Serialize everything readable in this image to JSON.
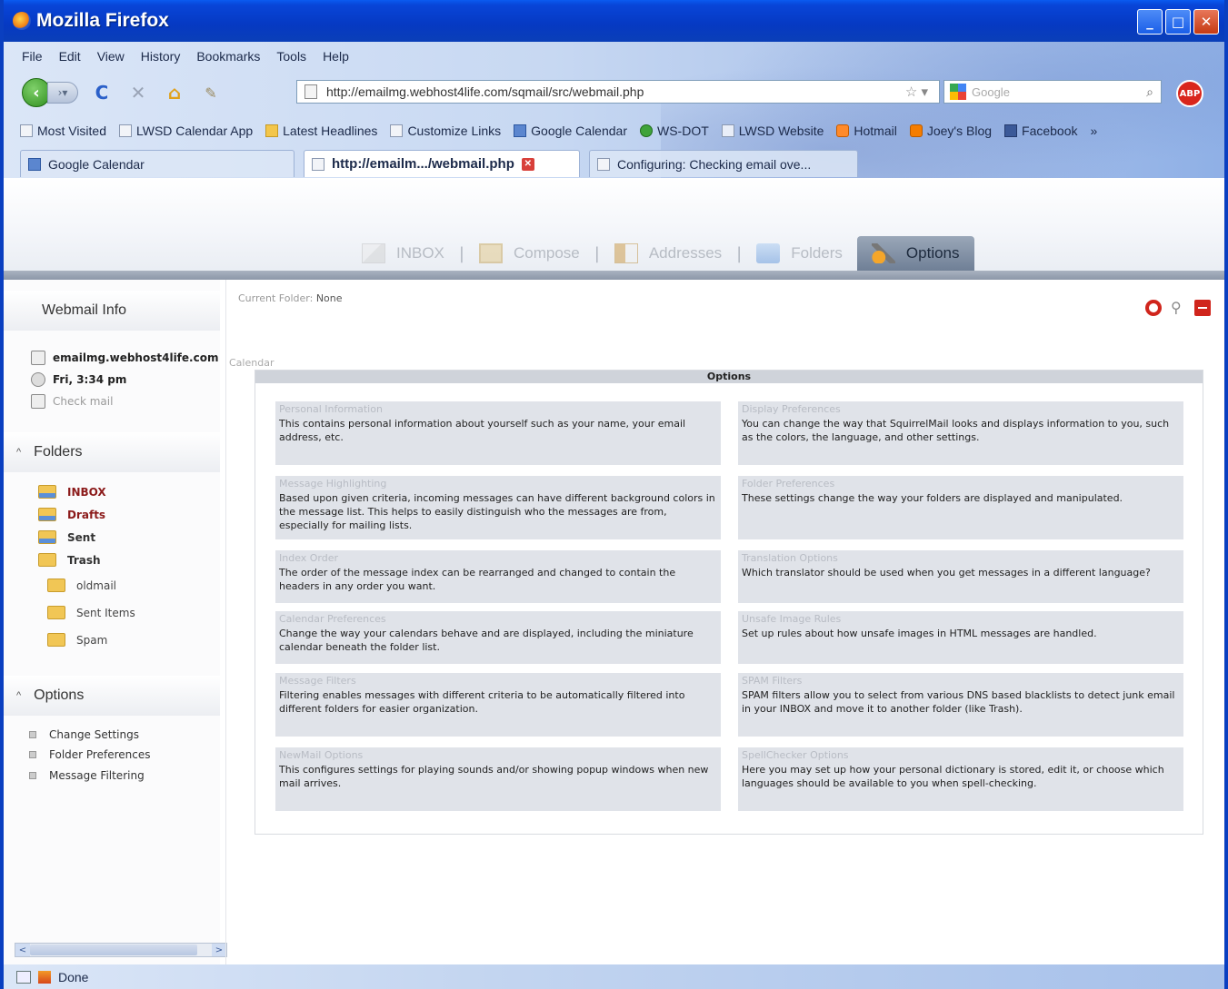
{
  "window": {
    "title": "Mozilla Firefox"
  },
  "menu": [
    "File",
    "Edit",
    "View",
    "History",
    "Bookmarks",
    "Tools",
    "Help"
  ],
  "toolbar": {
    "url": "http://emailmg.webhost4life.com/sqmail/src/webmail.php",
    "search_placeholder": "Google",
    "abp": "ABP"
  },
  "bookmarks": [
    "Most Visited",
    "LWSD Calendar App",
    "Latest Headlines",
    "Customize Links",
    "Google Calendar",
    "WS-DOT",
    "LWSD Website",
    "Hotmail",
    "Joey's Blog",
    "Facebook",
    "»"
  ],
  "tabs": [
    "Google Calendar",
    "http://emailm.../webmail.php",
    "Configuring: Checking email ove..."
  ],
  "sm_nav": [
    "INBOX",
    "Compose",
    "Addresses",
    "Folders",
    "Options"
  ],
  "sidebar": {
    "info_title": "Webmail Info",
    "server": "emailmg.webhost4life.com",
    "time": "Fri, 3:34 pm",
    "check_mail": "Check mail",
    "folders_title": "Folders",
    "folders": [
      "INBOX",
      "Drafts",
      "Sent",
      "Trash",
      "oldmail",
      "Sent Items",
      "Spam"
    ],
    "options_title": "Options",
    "options": [
      "Change Settings",
      "Folder Preferences",
      "Message Filtering"
    ]
  },
  "main": {
    "current_folder_label": "Current Folder:",
    "current_folder_value": "None",
    "calendar_text": "Calendar",
    "panel_title": "Options",
    "options_left": [
      {
        "title": "Personal Information",
        "desc": "This contains personal information about yourself such as your name, your email address, etc."
      },
      {
        "title": "Message Highlighting",
        "desc": "Based upon given criteria, incoming messages can have different background colors in the message list. This helps to easily distinguish who the messages are from, especially for mailing lists."
      },
      {
        "title": "Index Order",
        "desc": "The order of the message index can be rearranged and changed to contain the headers in any order you want."
      },
      {
        "title": "Calendar Preferences",
        "desc": "Change the way your calendars behave and are displayed, including the miniature calendar beneath the folder list."
      },
      {
        "title": "Message Filters",
        "desc": "Filtering enables messages with different criteria to be automatically filtered into different folders for easier organization."
      },
      {
        "title": "NewMail Options",
        "desc": "This configures settings for playing sounds and/or showing popup windows when new mail arrives."
      }
    ],
    "options_right": [
      {
        "title": "Display Preferences",
        "desc": "You can change the way that SquirrelMail looks and displays information to you, such as the colors, the language, and other settings."
      },
      {
        "title": "Folder Preferences",
        "desc": "These settings change the way your folders are displayed and manipulated."
      },
      {
        "title": "Translation Options",
        "desc": "Which translator should be used when you get messages in a different language?"
      },
      {
        "title": "Unsafe Image Rules",
        "desc": "Set up rules about how unsafe images in HTML messages are handled."
      },
      {
        "title": "SPAM Filters",
        "desc": "SPAM filters allow you to select from various DNS based blacklists to detect junk email in your INBOX and move it to another folder (like Trash)."
      },
      {
        "title": "SpellChecker Options",
        "desc": "Here you may set up how your personal dictionary is stored, edit it, or choose which languages should be available to you when spell-checking."
      }
    ]
  },
  "status": {
    "text": "Done"
  }
}
